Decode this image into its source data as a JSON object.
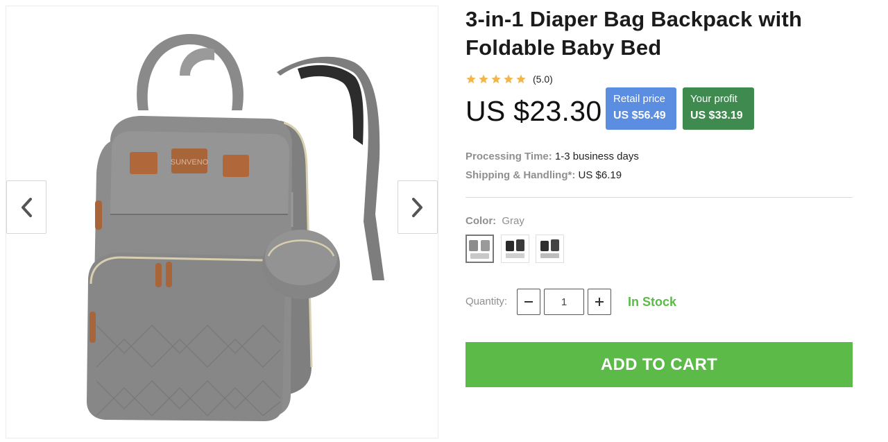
{
  "product": {
    "title": "3-in-1 Diaper Bag Backpack with Foldable Baby Bed",
    "rating": {
      "stars": 5,
      "text": "(5.0)",
      "star_color": "#f2b74b"
    },
    "price": "US $23.30",
    "retail": {
      "label": "Retail price",
      "value": "US $56.49",
      "color": "#5b8de0"
    },
    "profit": {
      "label": "Your profit",
      "value": "US $33.19",
      "color": "#3f8a4f"
    },
    "processing": {
      "label": "Processing Time:",
      "value": "1-3 business days"
    },
    "shipping": {
      "label": "Shipping & Handling*:",
      "value": "US $6.19"
    },
    "color": {
      "label": "Color:",
      "selected": "Gray"
    },
    "swatches": [
      "Gray",
      "Black",
      "Black/Gray"
    ],
    "quantity": {
      "label": "Quantity:",
      "value": "1"
    },
    "stock": "In Stock",
    "cart_label": "ADD TO CART",
    "accent_color": "#5cba48"
  },
  "gallery": {
    "prev_icon": "chevron-left-icon",
    "next_icon": "chevron-right-icon"
  }
}
